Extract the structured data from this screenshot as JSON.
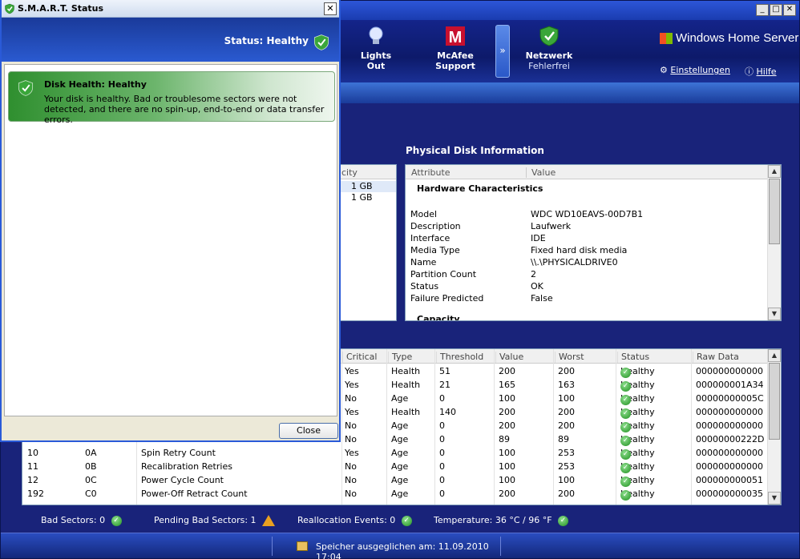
{
  "main": {
    "toolbar": {
      "lights_out": [
        "Lights",
        "Out"
      ],
      "mcafee": [
        "McAfee",
        "Support"
      ],
      "network": {
        "title": "Netzwerk",
        "status": "Fehlerfrei"
      },
      "logo": "Windows Home Server",
      "settings": "Einstellungen",
      "help": "Hilfe",
      "chevron": "»"
    },
    "disklist": {
      "header_fragment": "city",
      "rows": [
        "1 GB",
        "1 GB"
      ]
    },
    "physical": {
      "title": "Physical Disk Information",
      "columns": [
        "Attribute",
        "Value"
      ],
      "section": "Hardware Characteristics",
      "rows": [
        {
          "attr": "Model",
          "value": "WDC WD10EAVS-00D7B1"
        },
        {
          "attr": "Description",
          "value": "Laufwerk"
        },
        {
          "attr": "Interface",
          "value": "IDE"
        },
        {
          "attr": "Media Type",
          "value": "Fixed hard disk media"
        },
        {
          "attr": "Name",
          "value": "\\\\.\\PHYSICALDRIVE0"
        },
        {
          "attr": "Partition Count",
          "value": "2"
        },
        {
          "attr": "Status",
          "value": "OK"
        },
        {
          "attr": "Failure Predicted",
          "value": "False"
        }
      ],
      "next_section": "Capacity"
    },
    "attributes": {
      "columns": [
        "Critical",
        "Type",
        "Threshold",
        "Value",
        "Worst",
        "Status",
        "Raw Data"
      ],
      "rows": [
        {
          "id": "",
          "hex": "",
          "name": "",
          "critical": "Yes",
          "type": "Health",
          "threshold": "51",
          "value": "200",
          "worst": "200",
          "status": "Healthy",
          "raw": "000000000000"
        },
        {
          "id": "",
          "hex": "",
          "name": "",
          "critical": "Yes",
          "type": "Health",
          "threshold": "21",
          "value": "165",
          "worst": "163",
          "status": "Healthy",
          "raw": "000000001A34"
        },
        {
          "id": "",
          "hex": "",
          "name": "",
          "critical": "No",
          "type": "Age",
          "threshold": "0",
          "value": "100",
          "worst": "100",
          "status": "Healthy",
          "raw": "00000000005C"
        },
        {
          "id": "",
          "hex": "",
          "name": "",
          "critical": "Yes",
          "type": "Health",
          "threshold": "140",
          "value": "200",
          "worst": "200",
          "status": "Healthy",
          "raw": "000000000000"
        },
        {
          "id": "",
          "hex": "",
          "name": "",
          "critical": "No",
          "type": "Age",
          "threshold": "0",
          "value": "200",
          "worst": "200",
          "status": "Healthy",
          "raw": "000000000000"
        },
        {
          "id": "",
          "hex": "",
          "name": "",
          "critical": "No",
          "type": "Age",
          "threshold": "0",
          "value": "89",
          "worst": "89",
          "status": "Healthy",
          "raw": "00000000222D"
        },
        {
          "id": "10",
          "hex": "0A",
          "name": "Spin Retry Count",
          "critical": "Yes",
          "type": "Age",
          "threshold": "0",
          "value": "100",
          "worst": "253",
          "status": "Healthy",
          "raw": "000000000000"
        },
        {
          "id": "11",
          "hex": "0B",
          "name": "Recalibration Retries",
          "critical": "No",
          "type": "Age",
          "threshold": "0",
          "value": "100",
          "worst": "253",
          "status": "Healthy",
          "raw": "000000000000"
        },
        {
          "id": "12",
          "hex": "0C",
          "name": "Power Cycle Count",
          "critical": "No",
          "type": "Age",
          "threshold": "0",
          "value": "100",
          "worst": "100",
          "status": "Healthy",
          "raw": "000000000051"
        },
        {
          "id": "192",
          "hex": "C0",
          "name": "Power-Off Retract Count",
          "critical": "No",
          "type": "Age",
          "threshold": "0",
          "value": "200",
          "worst": "200",
          "status": "Healthy",
          "raw": "000000000035"
        }
      ]
    },
    "summary": {
      "bad_sectors": "Bad Sectors: 0",
      "pending": "Pending Bad Sectors: 1",
      "realloc": "Reallocation Events: 0",
      "temperature": "Temperature: 36 °C / 96 °F"
    },
    "footer": "Speicher ausgeglichen am: 11.09.2010 17:04"
  },
  "dialog": {
    "title": "S.M.A.R.T. Status",
    "status": "Status: Healthy",
    "card_title": "Disk Health: Healthy",
    "card_desc": "Your disk is healthy. Bad or troublesome sectors were not detected, and there are no spin-up, end-to-end or data transfer errors.",
    "close": "Close"
  },
  "colors": {
    "accent": "#2a5ad0",
    "healthy": "#2f8f2f",
    "warning": "#e8a020"
  }
}
